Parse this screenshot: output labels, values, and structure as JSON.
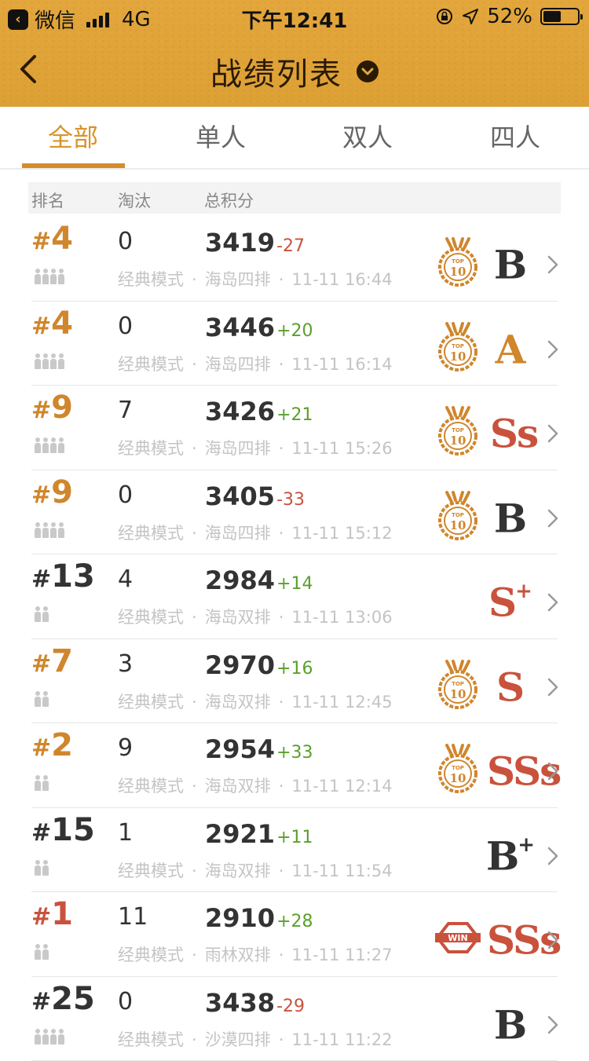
{
  "status_bar": {
    "back_app": "微信",
    "network": "4G",
    "time": "下午12:41",
    "battery": "52%",
    "battery_level": 0.52
  },
  "nav": {
    "title": "战绩列表"
  },
  "tabs": [
    "全部",
    "单人",
    "双人",
    "四人"
  ],
  "active_tab": 0,
  "table_header": {
    "rank": "排名",
    "kills": "淘汰",
    "score": "总积分"
  },
  "colors": {
    "accent": "#d58c2a",
    "rank_gold": "#d0862c",
    "rank_red": "#c9523d",
    "rank_dark": "#333333",
    "up": "#5aa02c",
    "down": "#c9523d"
  },
  "matches": [
    {
      "rank_hash": "#",
      "rank": "4",
      "rank_style": "gold",
      "team": 4,
      "kills": "0",
      "score": "3419",
      "delta": "-27",
      "mode": "经典模式",
      "map": "海岛四排",
      "time": "11-11 16:44",
      "badge": "top10",
      "grade": "B",
      "grade_sup": "",
      "grade_color": "#333333"
    },
    {
      "rank_hash": "#",
      "rank": "4",
      "rank_style": "gold",
      "team": 4,
      "kills": "0",
      "score": "3446",
      "delta": "+20",
      "mode": "经典模式",
      "map": "海岛四排",
      "time": "11-11 16:14",
      "badge": "top10",
      "grade": "A",
      "grade_sup": "",
      "grade_color": "#d0862c"
    },
    {
      "rank_hash": "#",
      "rank": "9",
      "rank_style": "gold",
      "team": 4,
      "kills": "7",
      "score": "3426",
      "delta": "+21",
      "mode": "经典模式",
      "map": "海岛四排",
      "time": "11-11 15:26",
      "badge": "top10",
      "grade": "Ss",
      "grade_sup": "",
      "grade_color": "#c9523d"
    },
    {
      "rank_hash": "#",
      "rank": "9",
      "rank_style": "gold",
      "team": 4,
      "kills": "0",
      "score": "3405",
      "delta": "-33",
      "mode": "经典模式",
      "map": "海岛四排",
      "time": "11-11 15:12",
      "badge": "top10",
      "grade": "B",
      "grade_sup": "",
      "grade_color": "#333333"
    },
    {
      "rank_hash": "#",
      "rank": "13",
      "rank_style": "dark",
      "team": 2,
      "kills": "4",
      "score": "2984",
      "delta": "+14",
      "mode": "经典模式",
      "map": "海岛双排",
      "time": "11-11 13:06",
      "badge": "",
      "grade": "S",
      "grade_sup": "+",
      "grade_color": "#c9523d"
    },
    {
      "rank_hash": "#",
      "rank": "7",
      "rank_style": "gold",
      "team": 2,
      "kills": "3",
      "score": "2970",
      "delta": "+16",
      "mode": "经典模式",
      "map": "海岛双排",
      "time": "11-11 12:45",
      "badge": "top10",
      "grade": "S",
      "grade_sup": "",
      "grade_color": "#c9523d"
    },
    {
      "rank_hash": "#",
      "rank": "2",
      "rank_style": "gold",
      "team": 2,
      "kills": "9",
      "score": "2954",
      "delta": "+33",
      "mode": "经典模式",
      "map": "海岛双排",
      "time": "11-11 12:14",
      "badge": "top10",
      "grade": "SSs",
      "grade_sup": "",
      "grade_color": "#c9523d"
    },
    {
      "rank_hash": "#",
      "rank": "15",
      "rank_style": "dark",
      "team": 2,
      "kills": "1",
      "score": "2921",
      "delta": "+11",
      "mode": "经典模式",
      "map": "海岛双排",
      "time": "11-11 11:54",
      "badge": "",
      "grade": "B",
      "grade_sup": "+",
      "grade_color": "#333333"
    },
    {
      "rank_hash": "#",
      "rank": "1",
      "rank_style": "red",
      "team": 2,
      "kills": "11",
      "score": "2910",
      "delta": "+28",
      "mode": "经典模式",
      "map": "雨林双排",
      "time": "11-11 11:27",
      "badge": "win",
      "grade": "SSs",
      "grade_sup": "",
      "grade_color": "#c9523d"
    },
    {
      "rank_hash": "#",
      "rank": "25",
      "rank_style": "dark",
      "team": 4,
      "kills": "0",
      "score": "3438",
      "delta": "-29",
      "mode": "经典模式",
      "map": "沙漠四排",
      "time": "11-11 11:22",
      "badge": "",
      "grade": "B",
      "grade_sup": "",
      "grade_color": "#333333"
    }
  ]
}
